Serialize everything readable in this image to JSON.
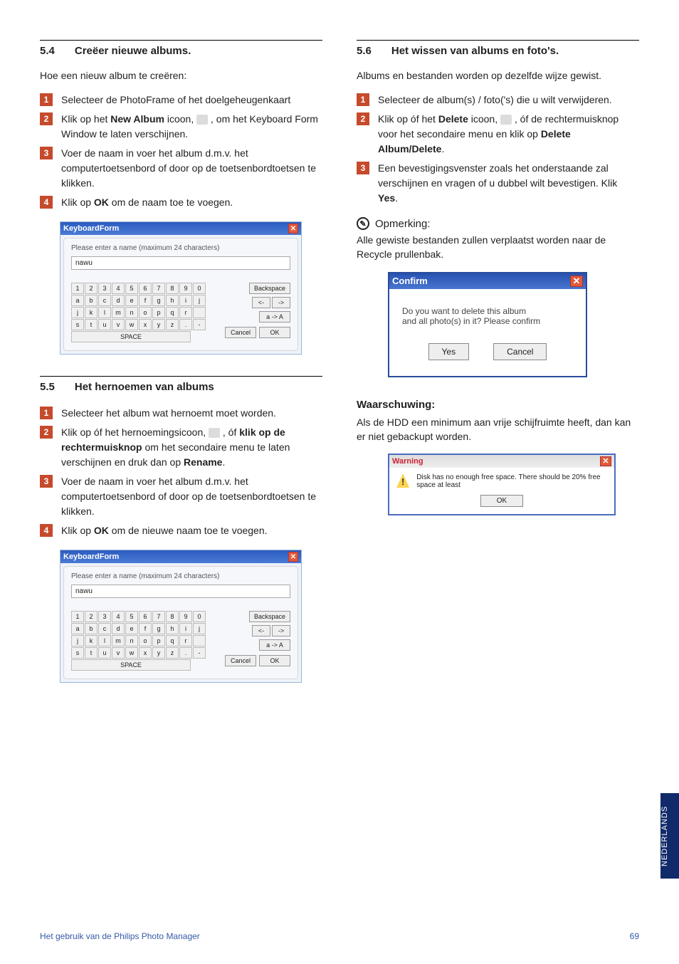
{
  "left": {
    "sec54_num": "5.4",
    "sec54_title": "Creëer nieuwe albums.",
    "sec54_intro": "Hoe een nieuw album te creëren:",
    "sec54_steps": {
      "s1": "Selecteer de PhotoFrame of het doelgeheugenkaart",
      "s2a": "Klik op het ",
      "s2b": "New Album",
      "s2c": " icoon, ",
      "s2d": " , om het Keyboard Form Window te laten verschijnen.",
      "s3": "Voer de naam in voer het album d.m.v. het computertoetsenbord of door op de toetsenbordtoetsen te klikken.",
      "s4a": "Klik op ",
      "s4b": "OK",
      "s4c": " om de naam toe te voegen."
    },
    "sec55_num": "5.5",
    "sec55_title": "Het hernoemen van albums",
    "sec55_steps": {
      "s1": "Selecteer het album wat hernoemt moet worden.",
      "s2a": "Klik op óf het hernoemingsicoon, ",
      "s2b": " , óf ",
      "s2c": "klik op de rechtermuisknop",
      "s2d": " om het secondaire menu te laten verschijnen en druk dan op ",
      "s2e": "Rename",
      "s2f": ".",
      "s3": "Voer de naam in voer het album d.m.v. het computertoetsenbord of door op de toetsenbordtoetsen te klikken.",
      "s4a": "Klik op ",
      "s4b": "OK",
      "s4c": " om de nieuwe naam toe te voegen."
    }
  },
  "right": {
    "sec56_num": "5.6",
    "sec56_title": "Het wissen van albums en foto's.",
    "sec56_intro": "Albums en bestanden worden op dezelfde wijze gewist.",
    "sec56_steps": {
      "s1": "Selecteer de album(s) / foto('s) die u wilt verwijderen.",
      "s2a": "Klik op óf het ",
      "s2b": "Delete",
      "s2c": " icoon, ",
      "s2d": " , óf de rechtermuisknop voor het secondaire menu en klik op ",
      "s2e": "Delete Album/Delete",
      "s2f": ".",
      "s3a": "Een bevestigingsvenster zoals het onderstaande zal verschijnen en vragen of u dubbel wilt bevestigen. Klik ",
      "s3b": "Yes",
      "s3c": "."
    },
    "note_label": "Opmerking:",
    "note_body": "Alle gewiste bestanden zullen verplaatst worden naar de Recycle prullenbak.",
    "warn_head": "Waarschuwing:",
    "warn_body": "Als de HDD een minimum aan vrije schijfruimte heeft, dan kan er niet gebackupt worden."
  },
  "kbform": {
    "title": "KeyboardForm",
    "prompt": "Please enter a name (maximum 24 characters)",
    "value": "nawu",
    "row1": [
      "1",
      "2",
      "3",
      "4",
      "5",
      "6",
      "7",
      "8",
      "9",
      "0"
    ],
    "row2": [
      "a",
      "b",
      "c",
      "d",
      "e",
      "f",
      "g",
      "h",
      "i",
      "j"
    ],
    "row3": [
      "j",
      "k",
      "l",
      "m",
      "n",
      "o",
      "p",
      "q",
      "r",
      " "
    ],
    "row4": [
      "s",
      "t",
      "u",
      "v",
      "w",
      "x",
      "y",
      "z",
      ".",
      "-"
    ],
    "space": "SPACE",
    "backspace": "Backspace",
    "left": "<-",
    "right": "->",
    "shift": "a -> A",
    "cancel": "Cancel",
    "ok": "OK"
  },
  "confirm": {
    "title": "Confirm",
    "line1": "Do you want to delete this album",
    "line2": "and all photo(s) in it? Please confirm",
    "yes": "Yes",
    "cancel": "Cancel"
  },
  "warning": {
    "title": "Warning",
    "msg": "Disk has no enough free space. There should be 20% free space at least",
    "ok": "OK"
  },
  "sidetab": "NEDERLANDS",
  "footer_left": "Het gebruik van de Philips Photo Manager",
  "footer_right": "69"
}
